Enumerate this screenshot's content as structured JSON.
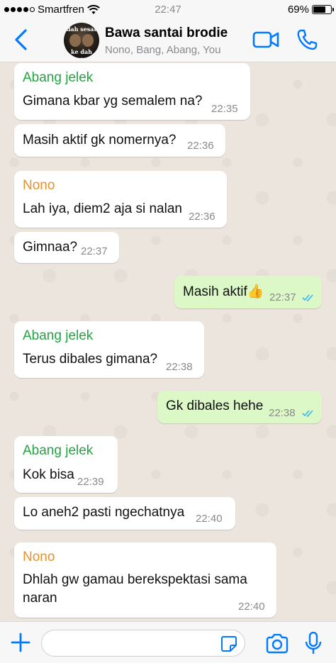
{
  "status_bar": {
    "carrier": "Smartfren",
    "time": "22:47",
    "battery": "69%",
    "battery_level": 0.69
  },
  "header": {
    "title": "Bawa santai brodie",
    "subtitle": "Nono, Bang, Abang, You",
    "avatar_caption_top": "dah sesat",
    "avatar_caption_bottom": "ke dah sesat"
  },
  "colors": {
    "accent": "#007aff",
    "incoming_bubble": "#ffffff",
    "outgoing_bubble": "#dcf8c6",
    "sender_abang": "#25a244",
    "sender_nono": "#e8902a",
    "read_ticks": "#34b7f1"
  },
  "messages": [
    {
      "direction": "in",
      "sender": "Abang jelek",
      "text": "Gimana kbar yg semalem na?",
      "time": "22:35"
    },
    {
      "direction": "in",
      "sender": "",
      "text": "Masih aktif gk nomernya?",
      "time": "22:36"
    },
    {
      "direction": "in",
      "sender": "Nono",
      "text": "Lah iya, diem2 aja si nalan",
      "time": "22:36"
    },
    {
      "direction": "in",
      "sender": "",
      "text": "Gimnaa?",
      "time": "22:37"
    },
    {
      "direction": "out",
      "sender": "",
      "text": "Masih aktif👍",
      "time": "22:37",
      "status": "read"
    },
    {
      "direction": "in",
      "sender": "Abang jelek",
      "text": "Terus dibales gimana?",
      "time": "22:38"
    },
    {
      "direction": "out",
      "sender": "",
      "text": "Gk dibales hehe",
      "time": "22:38",
      "status": "read"
    },
    {
      "direction": "in",
      "sender": "Abang jelek",
      "text": "Kok bisa",
      "time": "22:39"
    },
    {
      "direction": "in",
      "sender": "",
      "text": "Lo aneh2 pasti ngechatnya",
      "time": "22:40"
    },
    {
      "direction": "in",
      "sender": "Nono",
      "text": "Dhlah gw gamau berekspektasi sama naran",
      "time": "22:40"
    }
  ],
  "input_bar": {
    "placeholder": ""
  }
}
